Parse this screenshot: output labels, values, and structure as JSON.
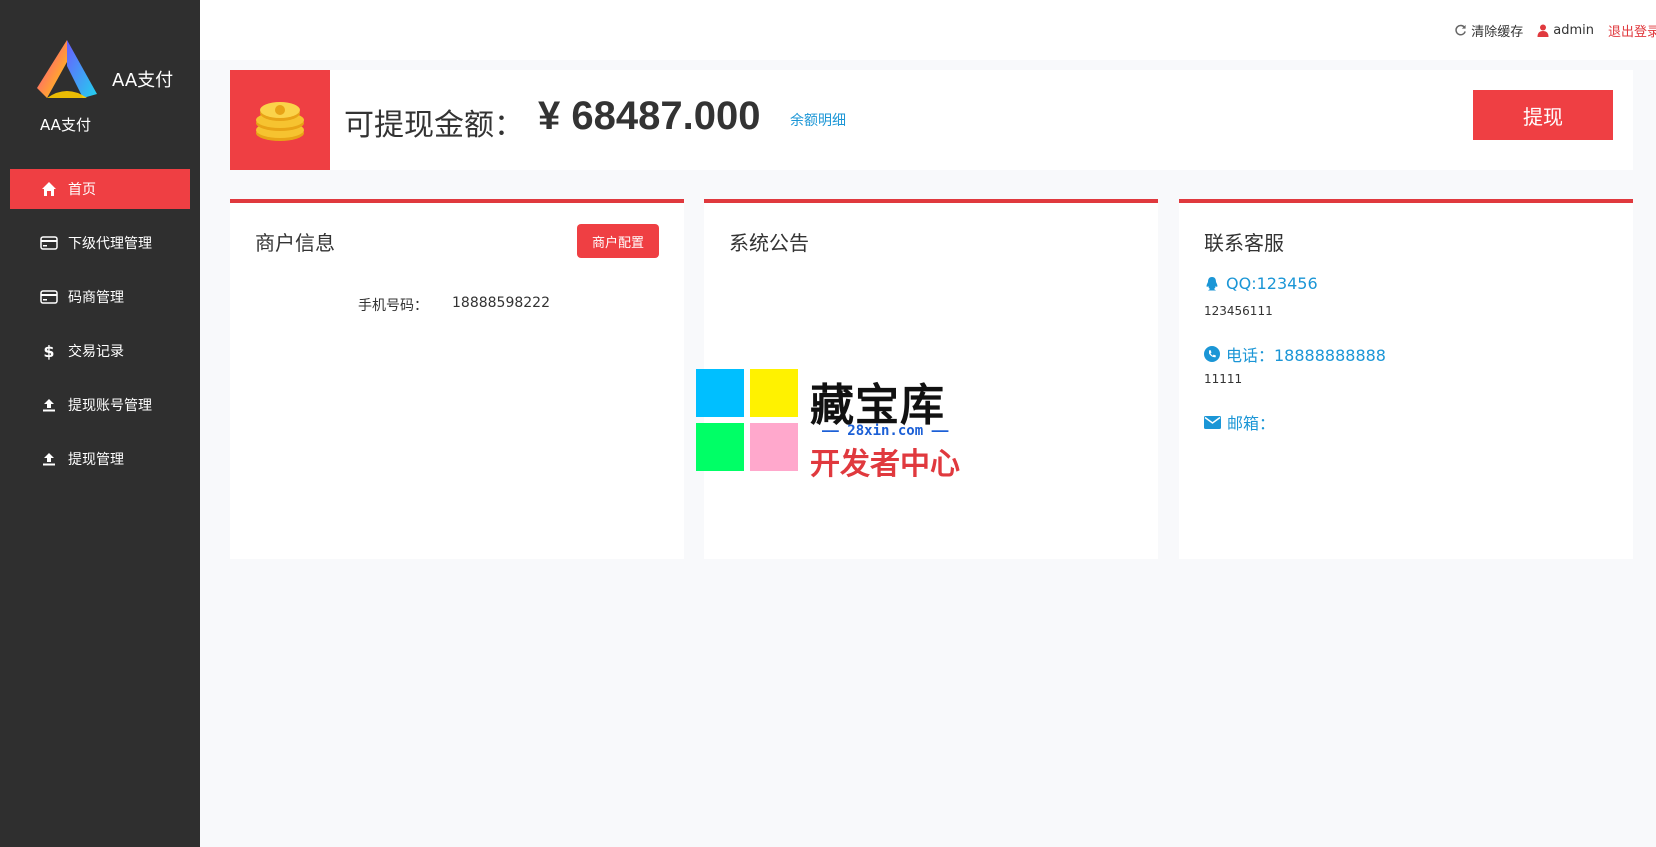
{
  "brand": {
    "name": "AA支付",
    "subtitle": "AA支付"
  },
  "sidebar": {
    "items": [
      {
        "label": "首页",
        "icon": "home-icon",
        "active": true
      },
      {
        "label": "下级代理管理",
        "icon": "card-icon"
      },
      {
        "label": "码商管理",
        "icon": "card-icon"
      },
      {
        "label": "交易记录",
        "icon": "dollar-icon"
      },
      {
        "label": "提现账号管理",
        "icon": "upload-icon"
      },
      {
        "label": "提现管理",
        "icon": "upload-icon"
      }
    ]
  },
  "topbar": {
    "clear_cache": "清除缓存",
    "user": "admin",
    "logout": "退出登录"
  },
  "balance": {
    "label": "可提现金额：",
    "amount": "¥ 68487.000",
    "detail_link": "余额明细",
    "withdraw_button": "提现"
  },
  "merchant": {
    "title": "商户信息",
    "config_button": "商户配置",
    "phone_label": "手机号码：",
    "phone_value": "18888598222"
  },
  "notice": {
    "title": "系统公告"
  },
  "contact": {
    "title": "联系客服",
    "qq_label": "QQ:123456",
    "qq_sub": "123456111",
    "phone_label": "电话：18888888888",
    "phone_sub": "11111",
    "email_label": "邮箱："
  },
  "watermark": {
    "line1": "藏宝库",
    "line2": "—— 28xin.com ——",
    "line3": "开发者中心"
  },
  "colors": {
    "accent": "#ef3f43",
    "sidebar_bg": "#2f2f2f",
    "link_blue": "#1b96d6"
  }
}
